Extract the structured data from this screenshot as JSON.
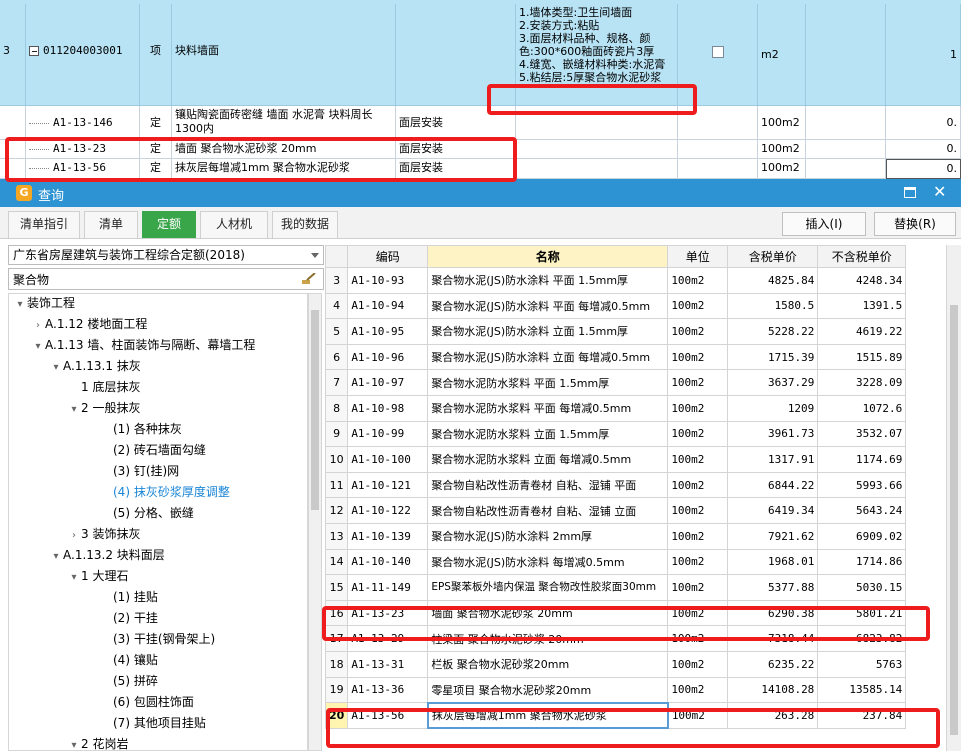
{
  "top_grid": {
    "main_row": {
      "row_no": "3",
      "code": "011204003001",
      "type": "项",
      "name": "块料墙面",
      "features": [
        "1.墙体类型:卫生间墙面",
        "2.安装方式:粘贴",
        "3.面层材料品种、规格、颜色:300*600釉面砖瓷片3厚",
        "4.缝宽、嵌缝材料种类:水泥膏",
        "5.粘结层:5厚聚合物水泥砂浆"
      ],
      "unit": "m2",
      "qty": "1"
    },
    "sub_rows": [
      {
        "code": "A1-13-146",
        "type": "定",
        "name": "镶贴陶瓷面砖密缝 墙面 水泥膏 块料周长1300内",
        "category": "面层安装",
        "unit": "100m2",
        "qty": "0."
      },
      {
        "code": "A1-13-23",
        "type": "定",
        "name": "墙面 聚合物水泥砂浆 20mm",
        "category": "面层安装",
        "unit": "100m2",
        "qty": "0."
      },
      {
        "code": "A1-13-56",
        "type": "定",
        "name": "抹灰层每增减1mm 聚合物水泥砂浆",
        "category": "面层安装",
        "unit": "100m2",
        "qty": "0."
      }
    ]
  },
  "dialog": {
    "title": "查询",
    "tabs": [
      "清单指引",
      "清单",
      "定额",
      "人材机",
      "我的数据"
    ],
    "active_tab": "定额",
    "insert_label": "插入(I)",
    "replace_label": "替换(R)",
    "library": "广东省房屋建筑与装饰工程综合定额(2018)",
    "search_value": "聚合物",
    "tree": [
      {
        "label": "装饰工程",
        "level": 0,
        "exp": "▾"
      },
      {
        "label": "A.1.12 楼地面工程",
        "level": 1,
        "exp": "›"
      },
      {
        "label": "A.1.13 墙、柱面装饰与隔断、幕墙工程",
        "level": 1,
        "exp": "▾"
      },
      {
        "label": "A.1.13.1 抹灰",
        "level": 2,
        "exp": "▾"
      },
      {
        "label": "1 底层抹灰",
        "level": 3,
        "exp": ""
      },
      {
        "label": "2 一般抹灰",
        "level": 3,
        "exp": "▾"
      },
      {
        "label": "(1) 各种抹灰",
        "level": 4,
        "exp": ""
      },
      {
        "label": "(2) 砖石墙面勾缝",
        "level": 4,
        "exp": ""
      },
      {
        "label": "(3) 钉(挂)网",
        "level": 4,
        "exp": ""
      },
      {
        "label": "(4) 抹灰砂浆厚度调整",
        "level": 4,
        "exp": "",
        "selected": true
      },
      {
        "label": "(5) 分格、嵌缝",
        "level": 4,
        "exp": ""
      },
      {
        "label": "3 装饰抹灰",
        "level": 3,
        "exp": "›"
      },
      {
        "label": "A.1.13.2 块料面层",
        "level": 2,
        "exp": "▾"
      },
      {
        "label": "1 大理石",
        "level": 3,
        "exp": "▾"
      },
      {
        "label": "(1) 挂贴",
        "level": 4,
        "exp": ""
      },
      {
        "label": "(2) 干挂",
        "level": 4,
        "exp": ""
      },
      {
        "label": "(3) 干挂(钢骨架上)",
        "level": 4,
        "exp": ""
      },
      {
        "label": "(4) 镶贴",
        "level": 4,
        "exp": ""
      },
      {
        "label": "(5) 拼碎",
        "level": 4,
        "exp": ""
      },
      {
        "label": "(6) 包圆柱饰面",
        "level": 4,
        "exp": ""
      },
      {
        "label": "(7) 其他项目挂贴",
        "level": 4,
        "exp": ""
      },
      {
        "label": "2 花岗岩",
        "level": 3,
        "exp": "▾"
      }
    ],
    "table": {
      "headers": [
        "",
        "编码",
        "名称",
        "单位",
        "含税单价",
        "不含税单价"
      ],
      "rows": [
        {
          "idx": "3",
          "code": "A1-10-93",
          "name": "聚合物水泥(JS)防水涂料 平面 1.5mm厚",
          "unit": "100m2",
          "tax": "4825.84",
          "notax": "4248.34"
        },
        {
          "idx": "4",
          "code": "A1-10-94",
          "name": "聚合物水泥(JS)防水涂料 平面 每增减0.5mm",
          "unit": "100m2",
          "tax": "1580.5",
          "notax": "1391.5"
        },
        {
          "idx": "5",
          "code": "A1-10-95",
          "name": "聚合物水泥(JS)防水涂料 立面 1.5mm厚",
          "unit": "100m2",
          "tax": "5228.22",
          "notax": "4619.22"
        },
        {
          "idx": "6",
          "code": "A1-10-96",
          "name": "聚合物水泥(JS)防水涂料 立面 每增减0.5mm",
          "unit": "100m2",
          "tax": "1715.39",
          "notax": "1515.89"
        },
        {
          "idx": "7",
          "code": "A1-10-97",
          "name": "聚合物水泥防水浆料 平面 1.5mm厚",
          "unit": "100m2",
          "tax": "3637.29",
          "notax": "3228.09"
        },
        {
          "idx": "8",
          "code": "A1-10-98",
          "name": "聚合物水泥防水浆料 平面 每增减0.5mm",
          "unit": "100m2",
          "tax": "1209",
          "notax": "1072.6"
        },
        {
          "idx": "9",
          "code": "A1-10-99",
          "name": "聚合物水泥防水浆料 立面 1.5mm厚",
          "unit": "100m2",
          "tax": "3961.73",
          "notax": "3532.07"
        },
        {
          "idx": "10",
          "code": "A1-10-100",
          "name": "聚合物水泥防水浆料 立面 每增减0.5mm",
          "unit": "100m2",
          "tax": "1317.91",
          "notax": "1174.69"
        },
        {
          "idx": "11",
          "code": "A1-10-121",
          "name": "聚合物自粘改性沥青卷材 自粘、湿铺 平面",
          "unit": "100m2",
          "tax": "6844.22",
          "notax": "5993.66"
        },
        {
          "idx": "12",
          "code": "A1-10-122",
          "name": "聚合物自粘改性沥青卷材 自粘、湿铺 立面",
          "unit": "100m2",
          "tax": "6419.34",
          "notax": "5643.24"
        },
        {
          "idx": "13",
          "code": "A1-10-139",
          "name": "聚合物水泥(JS)防水涂料 2mm厚",
          "unit": "100m2",
          "tax": "7921.62",
          "notax": "6909.02"
        },
        {
          "idx": "14",
          "code": "A1-10-140",
          "name": "聚合物水泥(JS)防水涂料 每增减0.5mm",
          "unit": "100m2",
          "tax": "1968.01",
          "notax": "1714.86"
        },
        {
          "idx": "15",
          "code": "A1-11-149",
          "name": "EPS聚苯板外墙内保温 聚合物改性胶浆面30mm",
          "unit": "100m2",
          "tax": "5377.88",
          "notax": "5030.15",
          "wrap": true
        },
        {
          "idx": "16",
          "code": "A1-13-23",
          "name": "墙面 聚合物水泥砂浆 20mm",
          "unit": "100m2",
          "tax": "6290.38",
          "notax": "5801.21"
        },
        {
          "idx": "17",
          "code": "A1-13-29",
          "name": "柱梁面 聚合物水泥砂浆 20mm",
          "unit": "100m2",
          "tax": "7318.44",
          "notax": "6823.82"
        },
        {
          "idx": "18",
          "code": "A1-13-31",
          "name": "栏板 聚合物水泥砂浆20mm",
          "unit": "100m2",
          "tax": "6235.22",
          "notax": "5763"
        },
        {
          "idx": "19",
          "code": "A1-13-36",
          "name": "零星项目 聚合物水泥砂浆20mm",
          "unit": "100m2",
          "tax": "14108.28",
          "notax": "13585.14"
        },
        {
          "idx": "20",
          "code": "A1-13-56",
          "name": "抹灰层每增减1mm 聚合物水泥砂浆",
          "unit": "100m2",
          "tax": "263.28",
          "notax": "237.84",
          "current": true
        }
      ]
    }
  },
  "colors": {
    "title_bar": "#2d93d3",
    "active_tab": "#3aa64a",
    "selected_row": "#b7e3f5",
    "highlight_box": "#ee1c1c",
    "tree_selected": "#1a86d6"
  }
}
